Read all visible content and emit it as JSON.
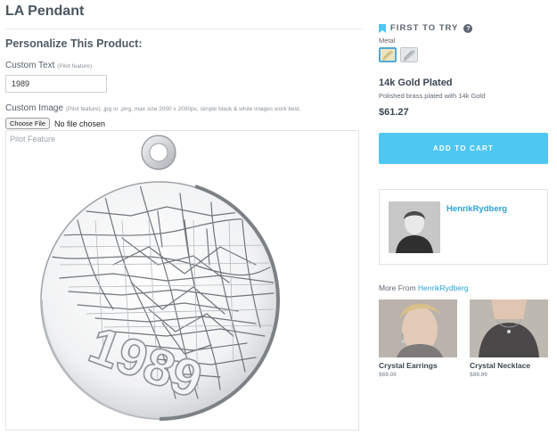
{
  "page": {
    "title": "LA Pendant"
  },
  "personalize": {
    "heading": "Personalize This Product:",
    "custom_text_label": "Custom Text",
    "custom_text_hint": "(Pilot feature)",
    "custom_text_value": "1989",
    "custom_image_label": "Custom Image",
    "custom_image_hint": "(Pilot feature) .jpg or .png, max size 2000 x 2000px, simple black & white images work best.",
    "choose_file_label": "Choose File",
    "file_status": "No file chosen"
  },
  "preview": {
    "label": "Pilot Feature",
    "engraved_text": "1989"
  },
  "material": {
    "ftt_label": "FIRST TO TRY",
    "help_icon": "?",
    "metal_label": "Metal",
    "name": "14k Gold Plated",
    "description": "Polished brass plated with 14k Gold",
    "price": "$61.27",
    "add_to_cart": "ADD TO CART",
    "colors": {
      "accent": "#4ec7f2",
      "link": "#2aa3d6",
      "gold": "#e9ddb0",
      "silver": "#cfd3d6"
    }
  },
  "designer": {
    "name": "HenrikRydberg"
  },
  "more_from": {
    "prefix": "More From ",
    "designer_link": "HenrikRydberg",
    "products": [
      {
        "name": "Crystal Earrings",
        "price": "$69.00"
      },
      {
        "name": "Crystal Necklace",
        "price": "$89.99"
      }
    ]
  }
}
